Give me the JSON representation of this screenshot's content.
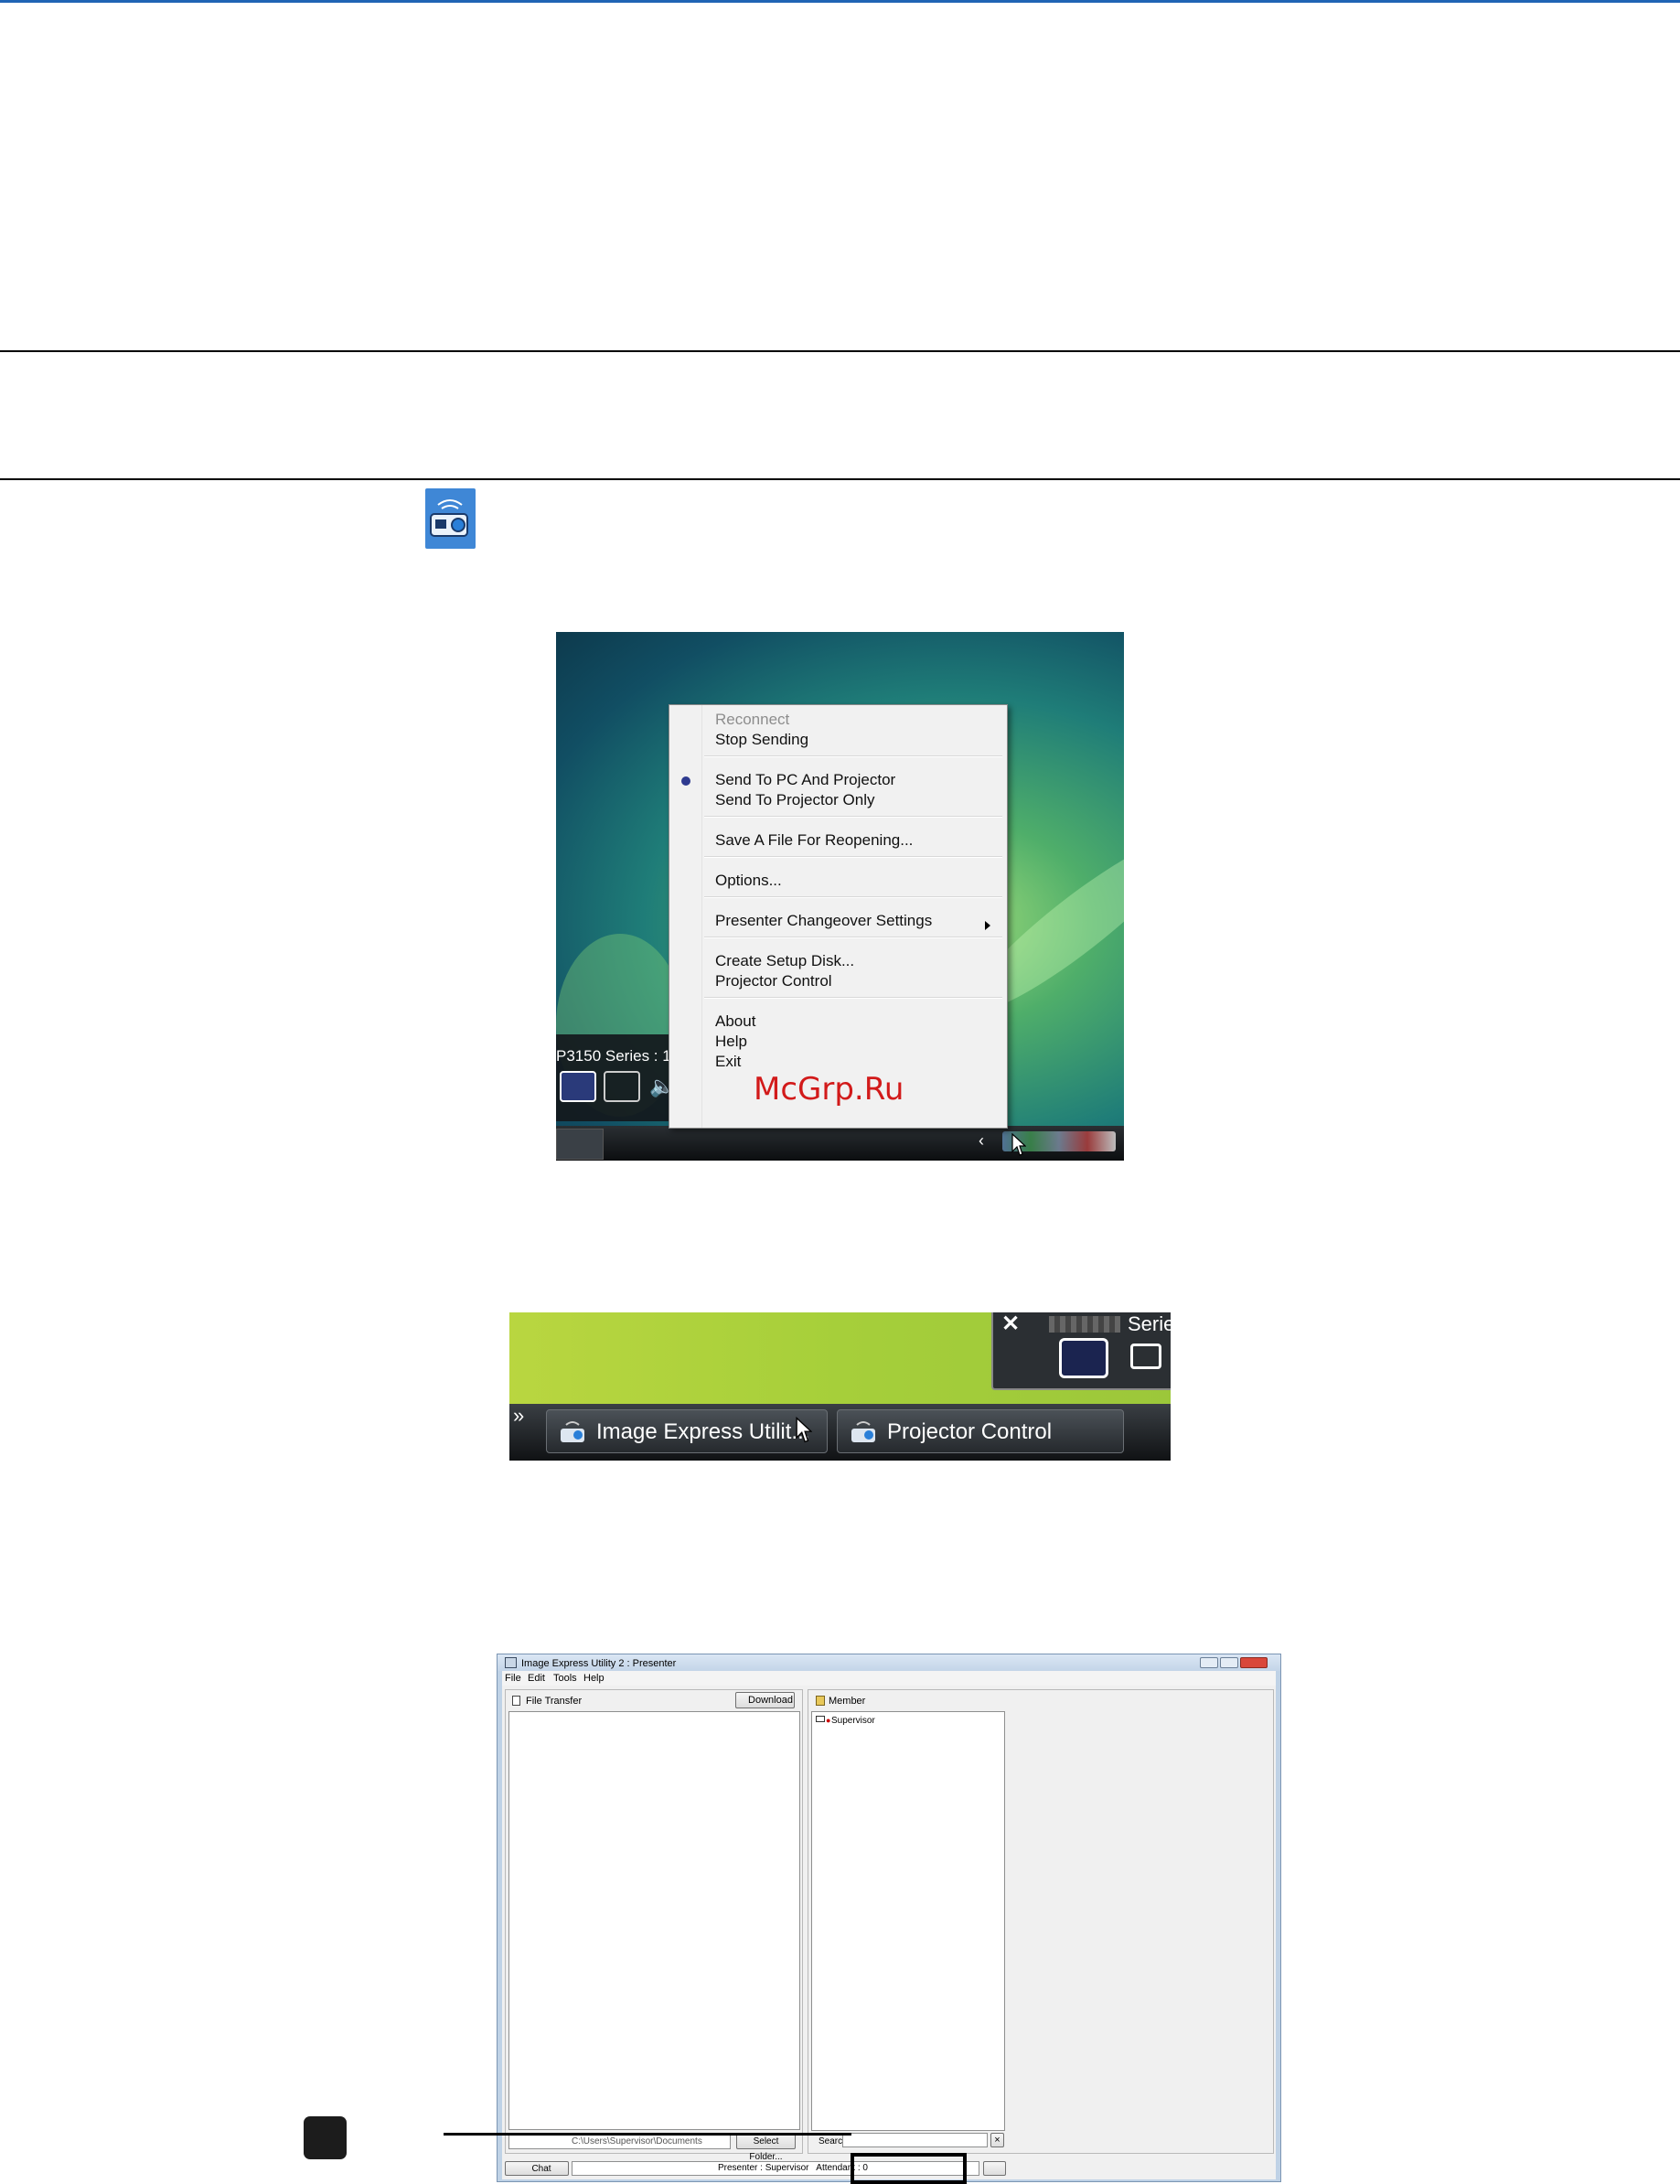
{
  "tray_menu": {
    "items": [
      {
        "label": "Reconnect",
        "disabled": true
      },
      {
        "label": "Stop Sending"
      },
      {
        "label": "Send To PC And Projector",
        "selected": true
      },
      {
        "label": "Send To Projector Only"
      },
      {
        "label": "Save A File For Reopening..."
      },
      {
        "label": "Options..."
      },
      {
        "label": "Presenter Changeover Settings",
        "submenu": true
      },
      {
        "label": "Create Setup Disk..."
      },
      {
        "label": "Projector Control"
      },
      {
        "label": "About"
      },
      {
        "label": "Help"
      },
      {
        "label": "Exit"
      }
    ]
  },
  "shot1": {
    "mini_title": "P3150 Series : 1"
  },
  "watermark": "McGrp.Ru",
  "taskbar": {
    "buttons": [
      {
        "label": "Image Express Utilit..."
      },
      {
        "label": "Projector Control"
      }
    ],
    "overflow": "»",
    "close_glyph": "✕",
    "series_partial": "Serie"
  },
  "window": {
    "title": "Image Express Utility 2 : Presenter",
    "menu": [
      "File",
      "Edit",
      "Tools",
      "Help"
    ],
    "file_transfer": {
      "label": "File Transfer",
      "download_label": "Download",
      "path": "C:\\Users\\Supervisor\\Documents",
      "select_folder_label": "Select Folder..."
    },
    "member": {
      "label": "Member",
      "entries": [
        "Supervisor"
      ],
      "search_label": "Search",
      "clear_glyph": "×"
    },
    "status": {
      "chat_label": "Chat",
      "text": "Presenter : Supervisor   Attendant : 0"
    }
  },
  "colors": {
    "accent": "#1f64b4",
    "menu_bullet": "#2e3a8f",
    "watermark": "#d21a1a",
    "tray_icon_bg": "#3f87d6"
  }
}
